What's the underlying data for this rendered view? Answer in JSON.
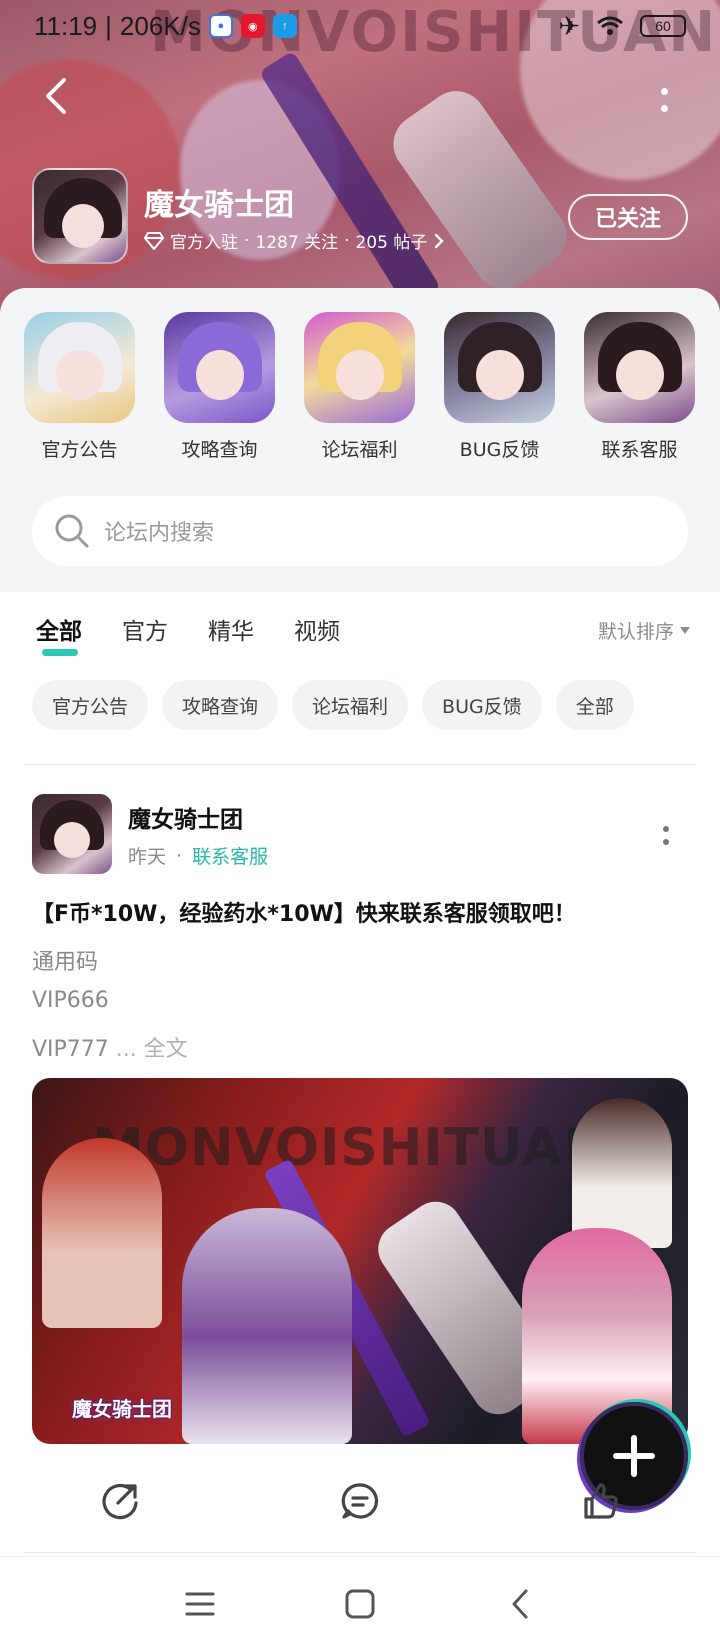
{
  "status": {
    "time": "11:19",
    "speed": "206K/s",
    "battery": "60"
  },
  "forum": {
    "name": "魔女骑士团",
    "badge": "官方入驻",
    "followers": "1287 关注",
    "posts": "205 帖子",
    "follow_label": "已关注",
    "watermark": "MONVOISHITUAN"
  },
  "shortcuts": [
    {
      "label": "官方公告",
      "icon": "announcement-thumb"
    },
    {
      "label": "攻略查询",
      "icon": "guide-thumb"
    },
    {
      "label": "论坛福利",
      "icon": "welfare-thumb"
    },
    {
      "label": "BUG反馈",
      "icon": "bug-feedback-thumb"
    },
    {
      "label": "联系客服",
      "icon": "customer-service-thumb"
    }
  ],
  "search": {
    "placeholder": "论坛内搜索"
  },
  "tabs": [
    {
      "label": "全部",
      "active": true
    },
    {
      "label": "官方",
      "active": false
    },
    {
      "label": "精华",
      "active": false
    },
    {
      "label": "视频",
      "active": false
    }
  ],
  "sort_label": "默认排序",
  "chips": [
    "官方公告",
    "攻略查询",
    "论坛福利",
    "BUG反馈",
    "全部"
  ],
  "post": {
    "author": "魔女骑士团",
    "time": "昨天",
    "tag": "联系客服",
    "title": "【F币*10W，经验药水*10W】快来联系客服领取吧！",
    "lines": [
      "通用码",
      "VIP666",
      "VIP777"
    ],
    "more_ellipsis": " ... ",
    "more_label": "全文",
    "image_logo": "魔女骑士团",
    "image_watermark": "MONVOISHITUAN"
  },
  "colors": {
    "accent": "#2bc6b6",
    "header": "#b0687a"
  }
}
